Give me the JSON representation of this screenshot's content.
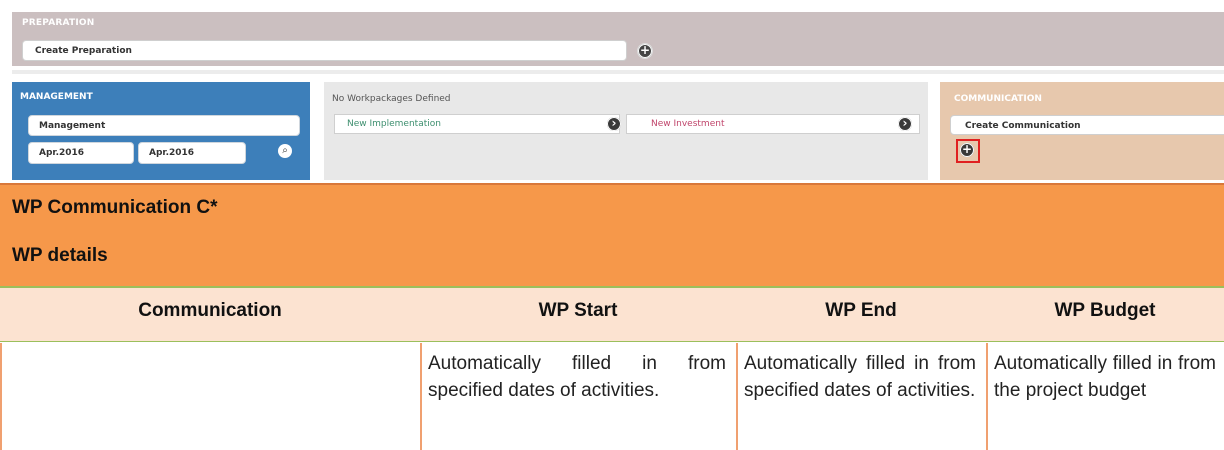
{
  "header": {
    "cut_label": ""
  },
  "preparation": {
    "title": "PREPARATION",
    "field_value": "Create Preparation",
    "add_icon": "plus-icon"
  },
  "management": {
    "title": "MANAGEMENT",
    "name_value": "Management",
    "start_value": "Apr.2016",
    "end_value": "Apr.2016",
    "search_icon": "magnifier-icon"
  },
  "workpackages": {
    "empty_text": "No Workpackages Defined",
    "implementation_placeholder": "New Implementation",
    "investment_placeholder": "New Investment"
  },
  "communication": {
    "title": "COMMUNICATION",
    "field_value": "Create Communication",
    "add_icon": "plus-icon"
  },
  "document": {
    "heading": "WP Communication C*",
    "subheading": "WP details",
    "table": {
      "headers": [
        "Communication",
        "WP Start",
        "WP End",
        "WP Budget"
      ],
      "row": [
        "",
        "Automatically filled in from specified dates of activities.",
        "Automatically filled in from specified dates of activities.",
        "Automatically filled in from the project budget"
      ]
    }
  },
  "colors": {
    "preparation_bg": "#cbbfc0",
    "management_bg": "#3d7fba",
    "communication_bg": "#e7c8ad",
    "orange_band": "#f6984a",
    "header_row": "#fce3d1",
    "highlight": "#e02020"
  }
}
